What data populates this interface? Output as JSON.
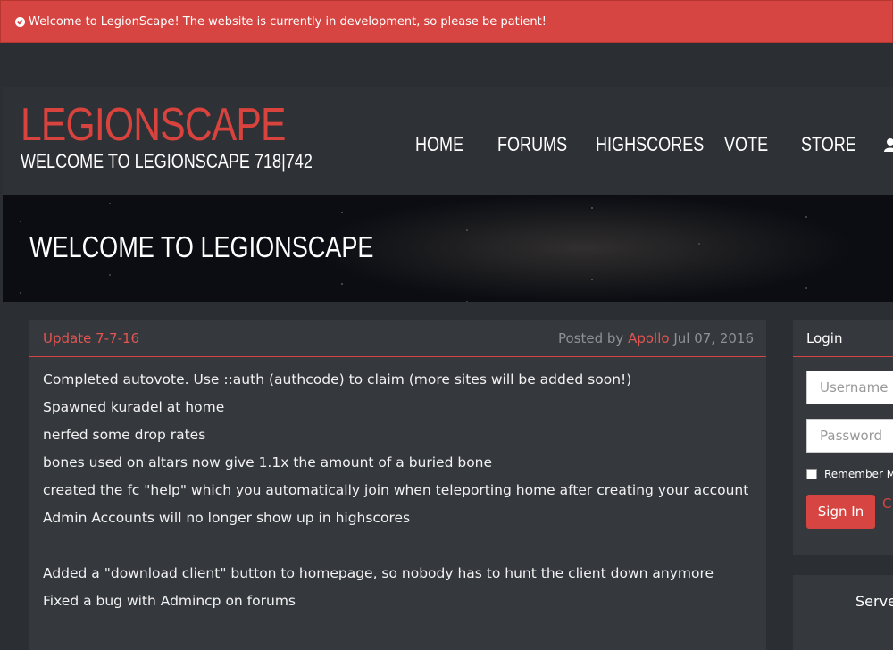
{
  "alert": {
    "text": "Welcome to LegionScape! The website is currently in development, so please be patient!"
  },
  "brand": {
    "title": "LEGIONSCAPE",
    "subtitle": "WELCOME TO LEGIONSCAPE 718|742"
  },
  "nav": {
    "home": "HOME",
    "forums": "FORUMS",
    "highscores": "HIGHSCORES",
    "vote": "VOTE",
    "store": "STORE"
  },
  "banner": {
    "title": "WELCOME TO LEGIONSCAPE"
  },
  "post": {
    "title": "Update 7-7-16",
    "posted_by": "Posted by",
    "author": "Apollo",
    "date": "Jul 07, 2016",
    "lines": [
      "Completed autovote. Use ::auth (authcode) to claim (more sites will be added soon!)",
      "Spawned kuradel at home",
      "nerfed some drop rates",
      "bones used on altars now give 1.1x the amount of a buried bone",
      "created the fc \"help\" which you automatically join when teleporting home after creating your account",
      "Admin Accounts will no longer show up in highscores",
      "",
      "Added a \"download client\" button to homepage, so nobody has to hunt the client down anymore",
      "Fixed a bug with Admincp on forums"
    ]
  },
  "login": {
    "title": "Login",
    "username_placeholder": "Username",
    "password_placeholder": "Password",
    "remember": "Remember M",
    "signin": "Sign In",
    "create": "C"
  },
  "server": {
    "title": "Serve"
  },
  "colors": {
    "accent": "#d64541",
    "background": "#2b2e32",
    "panel": "#35383d"
  },
  "icons": {
    "alert": "check-circle-icon",
    "home": "home-icon",
    "forums": "pencil-icon",
    "highscores": "list-icon",
    "vote": "check-square-icon",
    "store": "cart-icon",
    "account": "user-icon"
  }
}
